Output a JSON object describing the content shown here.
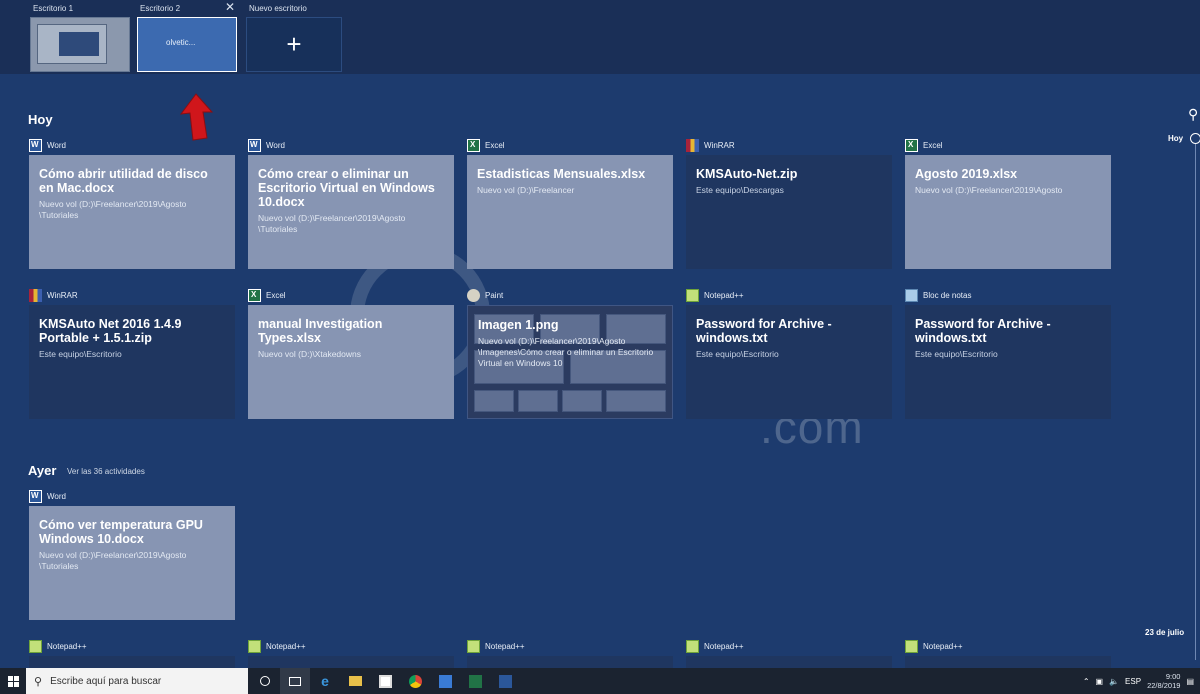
{
  "desktops": [
    {
      "label": "Escritorio 1"
    },
    {
      "label": "Escritorio 2",
      "close": "✕",
      "thumb_text": "olvetic..."
    },
    {
      "label": "Nuevo escritorio",
      "plus": "+"
    }
  ],
  "sections": {
    "today": {
      "title": "Hoy"
    },
    "yesterday": {
      "title": "Ayer",
      "link": "Ver las 36 actividades"
    }
  },
  "today_row1": [
    {
      "app": "Word",
      "title": "Cómo abrir utilidad de disco en Mac.docx",
      "path": "Nuevo vol (D:)\\Freelancer\\2019\\Agosto\n\\Tutoriales"
    },
    {
      "app": "Word",
      "title": "Cómo crear o eliminar un Escritorio Virtual en Windows 10.docx",
      "path": "Nuevo vol (D:)\\Freelancer\\2019\\Agosto\n\\Tutoriales"
    },
    {
      "app": "Excel",
      "title": "Estadisticas Mensuales.xlsx",
      "path": "Nuevo vol (D:)\\Freelancer"
    },
    {
      "app": "WinRAR",
      "title": "KMSAuto-Net.zip",
      "path": "Este equipo\\Descargas"
    },
    {
      "app": "Excel",
      "title": "Agosto  2019.xlsx",
      "path": "Nuevo vol (D:)\\Freelancer\\2019\\Agosto"
    }
  ],
  "today_row2": [
    {
      "app": "WinRAR",
      "title": "KMSAuto Net 2016 1.4.9 Portable + 1.5.1.zip",
      "path": "Este equipo\\Escritorio"
    },
    {
      "app": "Excel",
      "title": "manual Investigation Types.xlsx",
      "path": "Nuevo vol (D:)\\Xtakedowns"
    },
    {
      "app": "Paint",
      "title": "Imagen 1.png",
      "path": "Nuevo vol (D:)\\Freelancer\\2019\\Agosto\n\\Imagenes\\Cómo crear o eliminar un Escritorio Virtual en Windows 10"
    },
    {
      "app": "Notepad++",
      "title": "Password for Archive - windows.txt",
      "path": "Este equipo\\Escritorio"
    },
    {
      "app": "Bloc de notas",
      "title": "Password for Archive - windows.txt",
      "path": "Este equipo\\Escritorio"
    }
  ],
  "yesterday_row": [
    {
      "app": "Word",
      "title": "Cómo ver temperatura GPU Windows 10.docx",
      "path": "Nuevo vol (D:)\\Freelancer\\2019\\Agosto\n\\Tutoriales"
    }
  ],
  "bottom_row": [
    {
      "app": "Notepad++"
    },
    {
      "app": "Notepad++"
    },
    {
      "app": "Notepad++"
    },
    {
      "app": "Notepad++"
    },
    {
      "app": "Notepad++"
    }
  ],
  "timeline": {
    "today": "Hoy",
    "date": "23 de julio"
  },
  "watermark": ".com",
  "taskbar": {
    "search_placeholder": "Escribe aquí para buscar",
    "lang": "ESP",
    "time": "9:00",
    "date": "22/8/2019"
  },
  "colors": {
    "background": "#1d3b6e",
    "card_light": "#8795b3",
    "card_dark": "#1f3660",
    "arrow": "#d0161b"
  }
}
